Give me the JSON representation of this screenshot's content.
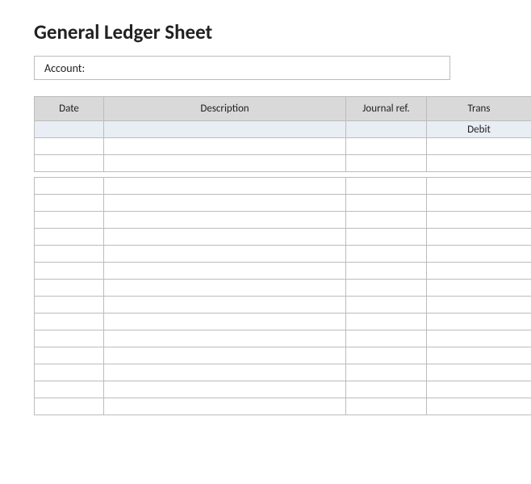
{
  "title": "General Ledger Sheet",
  "account": {
    "label": "Account:",
    "value": ""
  },
  "columns": {
    "date": "Date",
    "description": "Description",
    "journal_ref": "Journal ref.",
    "transaction": "Trans"
  },
  "subcolumns": {
    "debit": "Debit"
  },
  "rows": [
    {
      "date": "",
      "description": "",
      "journal_ref": "",
      "debit": ""
    },
    {
      "date": "",
      "description": "",
      "journal_ref": "",
      "debit": ""
    },
    {
      "date": "",
      "description": "",
      "journal_ref": "",
      "debit": ""
    },
    {
      "date": "",
      "description": "",
      "journal_ref": "",
      "debit": ""
    },
    {
      "date": "",
      "description": "",
      "journal_ref": "",
      "debit": ""
    },
    {
      "date": "",
      "description": "",
      "journal_ref": "",
      "debit": ""
    },
    {
      "date": "",
      "description": "",
      "journal_ref": "",
      "debit": ""
    },
    {
      "date": "",
      "description": "",
      "journal_ref": "",
      "debit": ""
    },
    {
      "date": "",
      "description": "",
      "journal_ref": "",
      "debit": ""
    },
    {
      "date": "",
      "description": "",
      "journal_ref": "",
      "debit": ""
    },
    {
      "date": "",
      "description": "",
      "journal_ref": "",
      "debit": ""
    },
    {
      "date": "",
      "description": "",
      "journal_ref": "",
      "debit": ""
    },
    {
      "date": "",
      "description": "",
      "journal_ref": "",
      "debit": ""
    },
    {
      "date": "",
      "description": "",
      "journal_ref": "",
      "debit": ""
    },
    {
      "date": "",
      "description": "",
      "journal_ref": "",
      "debit": ""
    },
    {
      "date": "",
      "description": "",
      "journal_ref": "",
      "debit": ""
    }
  ],
  "gap_after_row_index": 1
}
